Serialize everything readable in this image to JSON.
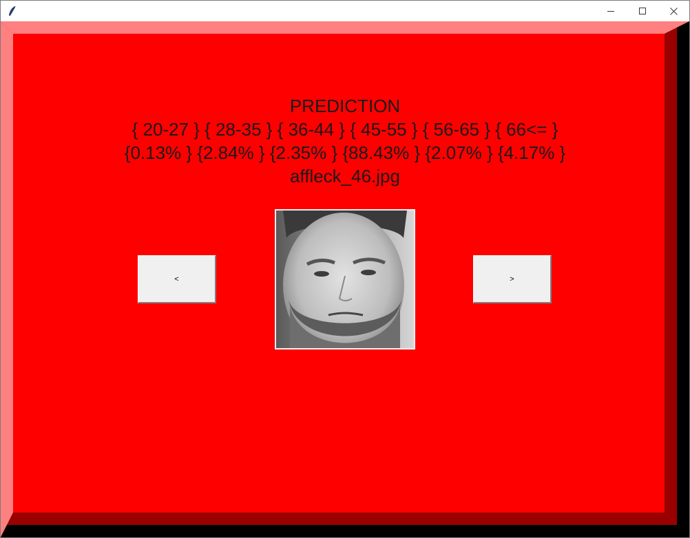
{
  "window": {
    "controls": {
      "minimize_icon": "minimize-icon",
      "maximize_icon": "maximize-icon",
      "close_icon": "close-icon"
    }
  },
  "colors": {
    "background": "#ff0000",
    "bevel_light": "#ff8080",
    "bevel_dark": "#990000",
    "button_face": "#f0f0f0"
  },
  "prediction": {
    "title": "PREDICTION",
    "ranges": "{ 20-27 } { 28-35 } { 36-44 } { 45-55 } { 56-65 } { 66<= }",
    "probabilities": "{0.13% } {2.84% } {2.35% } {88.43% } {2.07% } {4.17% }",
    "filename": "affleck_46.jpg"
  },
  "navigation": {
    "prev_label": "<",
    "next_label": ">"
  }
}
